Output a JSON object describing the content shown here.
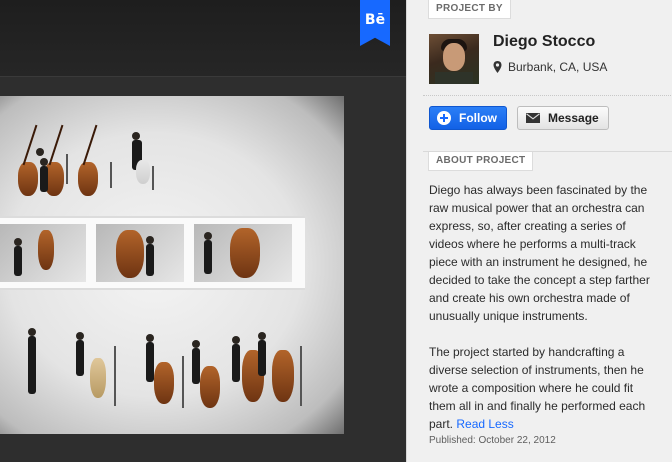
{
  "header": {
    "brand_badge": "Bē",
    "brand_color": "#1769ff"
  },
  "project_image": {
    "subject": "orchestra-of-cellists"
  },
  "sidebar": {
    "project_by_label": "PROJECT BY",
    "owner": {
      "name": "Diego Stocco",
      "location": "Burbank, CA, USA",
      "location_icon": "map-pin-icon"
    },
    "follow_label": "Follow",
    "follow_icon": "plus-circle-icon",
    "message_label": "Message",
    "message_icon": "envelope-icon",
    "about_label": "ABOUT PROJECT",
    "about_paragraph_1": "Diego has always been fascinated by the raw musical power that an orchestra can express, so, after creating a series of videos where he performs a multi-track piece with an instrument he designed, he decided to take the concept a step farther and create his own orchestra made of unusually unique instruments.",
    "about_paragraph_2": "The project started by handcrafting a diverse selection of instruments, then he wrote a composition where he could fit them all in and finally he performed each part.",
    "read_less_label": "Read Less",
    "published": "Published: October 22, 2012"
  },
  "colors": {
    "accent": "#1769ff",
    "sidebar_bg": "#f0f0f0",
    "page_bg": "#2e2e2e"
  }
}
